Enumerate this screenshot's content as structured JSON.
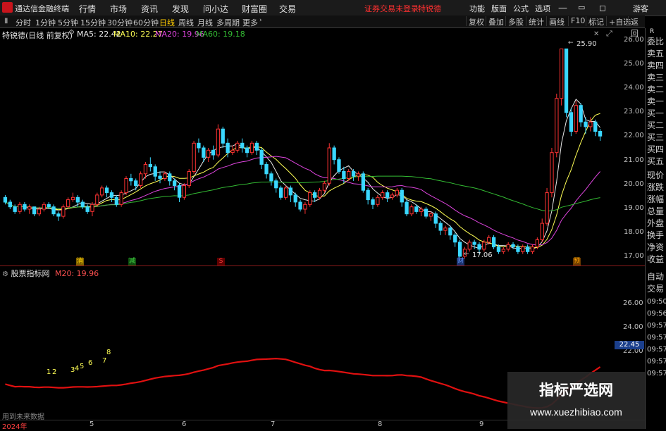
{
  "titlebar": {
    "app_name": "通达信金融终端",
    "menus": [
      "行情",
      "市场",
      "资讯",
      "发现",
      "问小达",
      "财富圈",
      "交易"
    ],
    "alert": "证券交易未登录",
    "alert2": "特锐德",
    "right_menus": [
      "功能",
      "版面",
      "公式",
      "选项"
    ],
    "guest": "游客"
  },
  "toolbar": {
    "periods": [
      "分时",
      "1分钟",
      "5分钟",
      "15分钟",
      "30分钟",
      "60分钟",
      "日线",
      "周线",
      "月线",
      "多周期",
      "更多"
    ],
    "active_period": "日线",
    "right_buttons": [
      "复权",
      "叠加",
      "多股",
      "统计",
      "画线",
      "F10",
      "标记",
      "+自选",
      "返回"
    ]
  },
  "infobar": {
    "stock": "特锐德(日线 前复权)",
    "ma5": "MA5: 22.42",
    "ma10": "MA10: 22.27",
    "ma20": "MA20: 19.96",
    "ma60": "MA60: 19.18"
  },
  "price_axis": [
    "26.00",
    "25.00",
    "24.00",
    "23.00",
    "22.00",
    "21.00",
    "20.00",
    "19.00",
    "18.00",
    "17.00"
  ],
  "price_annotations": {
    "high": "25.90",
    "low": "17.06"
  },
  "markers": [
    {
      "label": "消",
      "color": "#ffd700"
    },
    {
      "label": "减",
      "color": "#44cc44"
    },
    {
      "label": "S",
      "color": "#ff4040"
    },
    {
      "label": "财",
      "color": "#6699ff"
    },
    {
      "label": "预",
      "color": "#ffa500"
    }
  ],
  "indicator": {
    "name": "股票指标网",
    "param": "M20: 19.96",
    "axis": [
      "26.00",
      "24.00",
      "22.00"
    ],
    "last": "22.45",
    "digits": [
      "1",
      "2",
      "3",
      "4",
      "5",
      "6",
      "7",
      "8"
    ],
    "note": "用到未来数据"
  },
  "side_panel": {
    "labels": [
      "委比",
      "卖五",
      "卖四",
      "卖三",
      "卖二",
      "卖一",
      "买一",
      "买二",
      "买三",
      "买四",
      "买五",
      "现价",
      "涨跌",
      "涨幅",
      "总量",
      "外盘",
      "换手",
      "净资",
      "收益",
      "自动",
      "交易"
    ],
    "times": [
      "09:50",
      "09:56",
      "09:57",
      "09:57",
      "09:57",
      "09:57",
      "09:57"
    ]
  },
  "time_axis": [
    "2024年",
    "5",
    "6",
    "7",
    "8",
    "9"
  ],
  "watermark": {
    "title": "指标严选网",
    "url": "www.xuezhibiao.com"
  },
  "colors": {
    "up": "#ff3333",
    "down": "#3ad7ff",
    "ma5": "#e8e8e8",
    "ma10": "#ffff55",
    "ma20": "#dd44dd",
    "ma60": "#33bb33",
    "indicator_line": "#e01010"
  },
  "chart_data": {
    "type": "candlestick",
    "ylim": [
      16.8,
      26.3
    ],
    "candles": [
      [
        19.6,
        19.4,
        19.7,
        19.3
      ],
      [
        19.4,
        19.2,
        19.5,
        19.1
      ],
      [
        19.2,
        19.0,
        19.3,
        18.9
      ],
      [
        19.0,
        19.3,
        19.4,
        18.9
      ],
      [
        19.3,
        19.1,
        19.4,
        19.0
      ],
      [
        19.1,
        19.2,
        19.3,
        18.9
      ],
      [
        19.2,
        18.9,
        19.2,
        18.8
      ],
      [
        18.9,
        19.1,
        19.2,
        18.8
      ],
      [
        19.1,
        19.3,
        19.4,
        19.0
      ],
      [
        19.3,
        19.2,
        19.4,
        19.1
      ],
      [
        19.2,
        18.9,
        19.3,
        18.8
      ],
      [
        18.9,
        18.8,
        19.0,
        18.6
      ],
      [
        18.8,
        19.2,
        19.3,
        18.7
      ],
      [
        19.2,
        19.5,
        19.6,
        19.1
      ],
      [
        19.5,
        19.6,
        19.8,
        19.4
      ],
      [
        19.6,
        19.4,
        19.7,
        19.2
      ],
      [
        19.4,
        19.2,
        19.5,
        19.1
      ],
      [
        19.2,
        19.0,
        19.3,
        18.9
      ],
      [
        19.0,
        19.3,
        19.4,
        18.8
      ],
      [
        19.3,
        19.7,
        19.8,
        19.2
      ],
      [
        19.7,
        20.0,
        20.1,
        19.6
      ],
      [
        20.0,
        19.8,
        20.1,
        19.6
      ],
      [
        19.8,
        19.6,
        19.9,
        19.4
      ],
      [
        19.6,
        19.3,
        19.7,
        19.2
      ],
      [
        19.3,
        19.8,
        19.9,
        19.2
      ],
      [
        19.8,
        20.4,
        20.5,
        19.7
      ],
      [
        20.4,
        20.3,
        20.6,
        20.1
      ],
      [
        20.3,
        20.1,
        20.4,
        19.9
      ],
      [
        20.1,
        20.6,
        20.7,
        20.0
      ],
      [
        20.6,
        21.0,
        21.1,
        20.4
      ],
      [
        21.0,
        20.9,
        21.3,
        20.7
      ],
      [
        20.9,
        20.5,
        21.0,
        20.3
      ],
      [
        20.5,
        20.4,
        20.7,
        20.2
      ],
      [
        20.4,
        20.6,
        20.7,
        20.3
      ],
      [
        20.6,
        20.3,
        20.7,
        20.1
      ],
      [
        20.3,
        20.1,
        20.4,
        19.9
      ],
      [
        20.1,
        19.6,
        20.2,
        19.4
      ],
      [
        19.6,
        20.1,
        20.2,
        19.5
      ],
      [
        20.1,
        20.7,
        20.8,
        20.0
      ],
      [
        20.7,
        21.9,
        22.0,
        20.6
      ],
      [
        21.9,
        21.7,
        22.1,
        21.5
      ],
      [
        21.7,
        21.3,
        21.8,
        21.1
      ],
      [
        21.3,
        21.6,
        21.7,
        21.1
      ],
      [
        21.6,
        21.4,
        21.8,
        21.2
      ],
      [
        21.4,
        22.5,
        22.7,
        21.3
      ],
      [
        22.5,
        21.9,
        22.6,
        21.7
      ],
      [
        21.9,
        21.5,
        22.1,
        21.3
      ],
      [
        21.5,
        21.6,
        21.8,
        21.4
      ],
      [
        21.6,
        21.9,
        22.0,
        21.5
      ],
      [
        21.9,
        21.7,
        22.1,
        21.5
      ],
      [
        21.7,
        21.5,
        21.8,
        21.3
      ],
      [
        21.5,
        21.9,
        22.0,
        21.4
      ],
      [
        21.9,
        21.6,
        22.0,
        21.4
      ],
      [
        21.6,
        21.0,
        21.7,
        20.8
      ],
      [
        21.0,
        20.6,
        21.1,
        20.4
      ],
      [
        20.6,
        20.3,
        20.7,
        20.1
      ],
      [
        20.3,
        20.0,
        20.4,
        19.8
      ],
      [
        20.0,
        19.6,
        20.1,
        19.5
      ],
      [
        19.6,
        20.0,
        20.1,
        19.5
      ],
      [
        20.0,
        19.7,
        20.1,
        19.4
      ],
      [
        19.7,
        19.4,
        19.8,
        19.2
      ],
      [
        19.4,
        19.1,
        19.5,
        19.0
      ],
      [
        19.1,
        19.3,
        19.4,
        18.9
      ],
      [
        19.3,
        19.8,
        19.9,
        19.2
      ],
      [
        19.8,
        19.6,
        19.9,
        19.4
      ],
      [
        19.6,
        19.9,
        20.0,
        19.5
      ],
      [
        19.9,
        20.2,
        20.3,
        19.8
      ],
      [
        20.2,
        21.7,
        21.9,
        20.1
      ],
      [
        21.7,
        21.2,
        21.8,
        21.0
      ],
      [
        21.2,
        20.7,
        21.3,
        20.6
      ],
      [
        20.7,
        20.4,
        20.9,
        20.2
      ],
      [
        20.4,
        20.7,
        20.8,
        20.3
      ],
      [
        20.7,
        20.5,
        20.8,
        20.3
      ],
      [
        20.5,
        20.6,
        20.7,
        20.3
      ],
      [
        20.6,
        19.9,
        20.7,
        19.8
      ],
      [
        19.9,
        19.5,
        20.0,
        19.3
      ],
      [
        19.5,
        19.3,
        19.6,
        19.1
      ],
      [
        19.3,
        19.6,
        19.7,
        19.2
      ],
      [
        19.6,
        19.8,
        19.9,
        19.5
      ],
      [
        19.8,
        19.6,
        19.9,
        19.4
      ],
      [
        19.6,
        19.7,
        19.8,
        19.5
      ],
      [
        19.7,
        19.9,
        20.0,
        19.6
      ],
      [
        19.9,
        19.4,
        20.0,
        19.2
      ],
      [
        19.4,
        18.9,
        19.5,
        18.8
      ],
      [
        18.9,
        19.2,
        19.3,
        18.8
      ],
      [
        19.2,
        19.0,
        19.3,
        18.9
      ],
      [
        19.0,
        19.1,
        19.2,
        18.8
      ],
      [
        19.1,
        18.8,
        19.2,
        18.7
      ],
      [
        18.8,
        18.9,
        19.0,
        18.6
      ],
      [
        18.9,
        18.5,
        19.0,
        18.3
      ],
      [
        18.5,
        18.2,
        18.6,
        18.0
      ],
      [
        18.2,
        18.3,
        18.4,
        18.0
      ],
      [
        18.3,
        18.0,
        18.4,
        17.8
      ],
      [
        18.0,
        17.7,
        18.1,
        17.5
      ],
      [
        17.7,
        17.1,
        17.8,
        17.06
      ],
      [
        17.1,
        17.4,
        17.5,
        17.0
      ],
      [
        17.4,
        17.7,
        17.8,
        17.3
      ],
      [
        17.7,
        17.6,
        17.8,
        17.4
      ],
      [
        17.6,
        17.4,
        17.7,
        17.2
      ],
      [
        17.4,
        17.7,
        17.8,
        17.3
      ],
      [
        17.7,
        17.9,
        18.0,
        17.6
      ],
      [
        17.9,
        17.5,
        18.0,
        17.4
      ],
      [
        17.5,
        17.3,
        17.6,
        17.2
      ],
      [
        17.3,
        17.4,
        17.5,
        17.2
      ],
      [
        17.4,
        17.6,
        17.7,
        17.3
      ],
      [
        17.6,
        17.5,
        17.7,
        17.4
      ],
      [
        17.5,
        17.3,
        17.6,
        17.2
      ],
      [
        17.3,
        17.5,
        17.6,
        17.2
      ],
      [
        17.5,
        17.3,
        17.6,
        17.2
      ],
      [
        17.3,
        17.5,
        17.6,
        17.2
      ],
      [
        17.5,
        17.8,
        17.9,
        17.4
      ],
      [
        17.8,
        18.5,
        18.7,
        17.7
      ],
      [
        18.5,
        19.8,
        20.0,
        18.4
      ],
      [
        19.8,
        21.5,
        21.7,
        19.6
      ],
      [
        21.5,
        23.8,
        24.0,
        21.3
      ],
      [
        23.8,
        25.9,
        25.9,
        23.5
      ],
      [
        25.9,
        23.2,
        25.9,
        23.0
      ],
      [
        23.2,
        22.4,
        23.4,
        22.2
      ],
      [
        22.4,
        23.5,
        23.7,
        22.3
      ],
      [
        23.5,
        22.8,
        23.6,
        22.6
      ],
      [
        22.8,
        22.6,
        23.0,
        22.3
      ],
      [
        22.6,
        22.8,
        23.0,
        22.4
      ],
      [
        22.8,
        22.4,
        22.9,
        22.2
      ],
      [
        22.4,
        22.2,
        22.5,
        22.0
      ]
    ],
    "ma_series": [
      {
        "name": "MA5",
        "values": []
      },
      {
        "name": "MA10",
        "values": []
      },
      {
        "name": "MA20",
        "values": []
      },
      {
        "name": "MA60",
        "values": []
      }
    ]
  }
}
